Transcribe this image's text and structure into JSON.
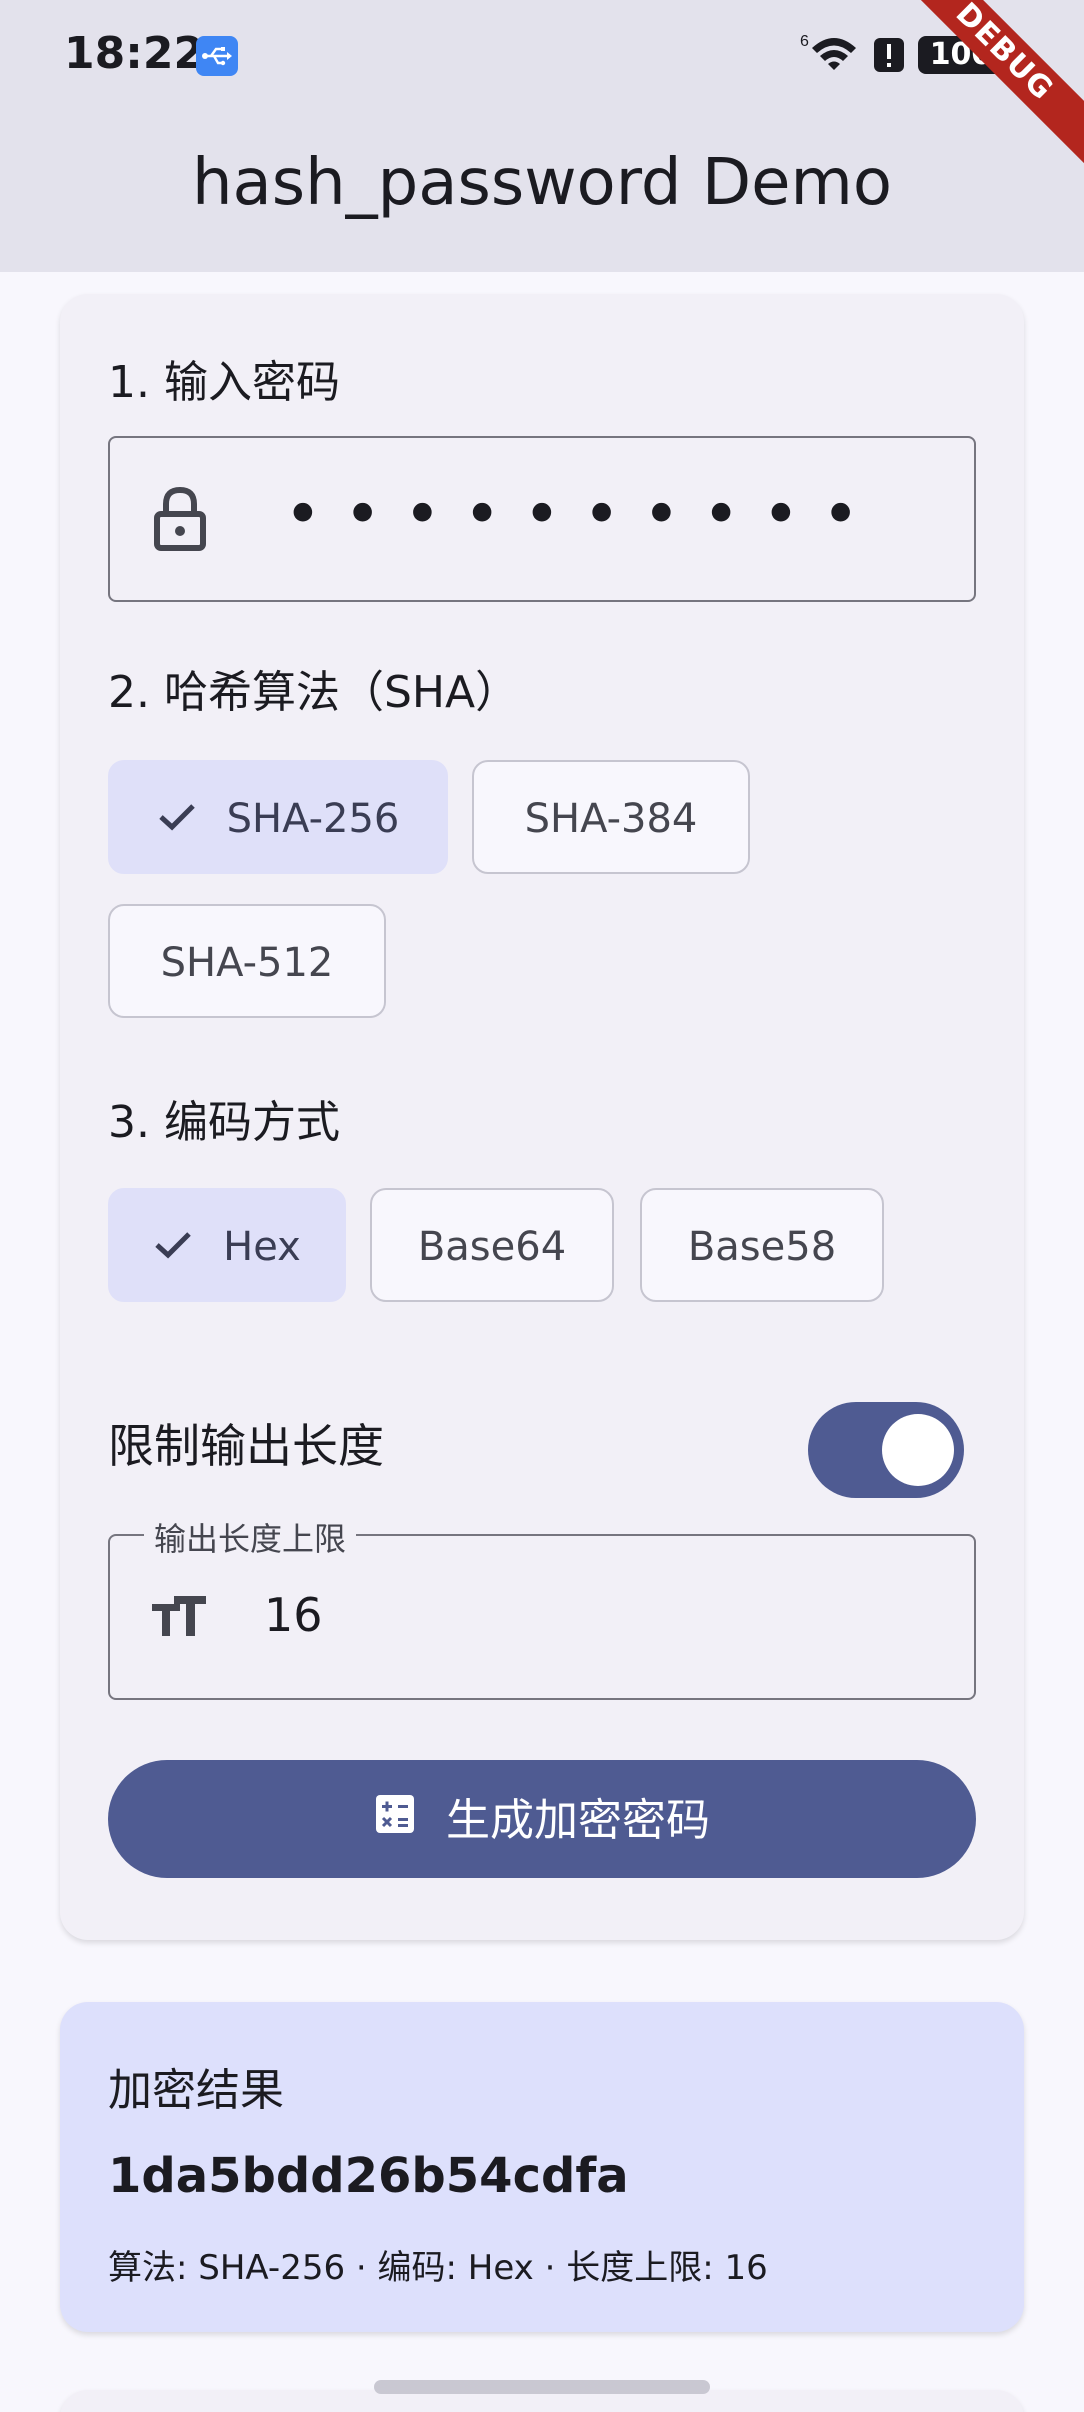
{
  "status_bar": {
    "time": "18:22",
    "battery": "100"
  },
  "debug_banner": "DEBUG",
  "app_bar": {
    "title": "hash_password Demo"
  },
  "form": {
    "step1_label": "1. 输入密码",
    "password_mask": "••••••••••",
    "step2_label": "2. 哈希算法（SHA）",
    "algorithms": [
      {
        "label": "SHA-256",
        "selected": true
      },
      {
        "label": "SHA-384",
        "selected": false
      },
      {
        "label": "SHA-512",
        "selected": false
      }
    ],
    "step3_label": "3. 编码方式",
    "encodings": [
      {
        "label": "Hex",
        "selected": true
      },
      {
        "label": "Base64",
        "selected": false
      },
      {
        "label": "Base58",
        "selected": false
      }
    ],
    "limit_toggle_label": "限制输出长度",
    "limit_enabled": true,
    "length_field_label": "输出长度上限",
    "length_value": "16",
    "generate_label": "生成加密密码"
  },
  "result": {
    "title": "加密结果",
    "hash": "1da5bdd26b54cdfa",
    "meta": "算法: SHA-256 · 编码: Hex · 长度上限: 16"
  },
  "colors": {
    "primary": "#4f5b92",
    "chip_selected": "#dfe0f9",
    "result_bg": "#dde0fc",
    "debug": "#b3261e"
  }
}
